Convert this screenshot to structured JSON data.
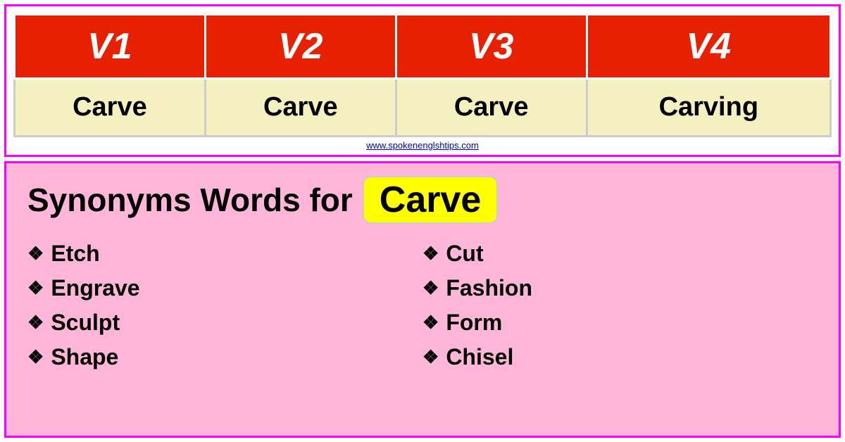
{
  "table": {
    "headers": [
      "V1",
      "V2",
      "V3",
      "V4"
    ],
    "row": [
      "Carve",
      "Carve",
      "Carve",
      "Carving"
    ],
    "website": "www.spokenenglshtips.com"
  },
  "synonyms": {
    "title_prefix": "Synonyms Words for",
    "highlight_word": "Carve",
    "items_left": [
      "Etch",
      "Engrave",
      "Sculpt",
      "Shape"
    ],
    "items_right": [
      "Cut",
      "Fashion",
      "Form",
      "Chisel"
    ]
  },
  "bullet": "❖"
}
